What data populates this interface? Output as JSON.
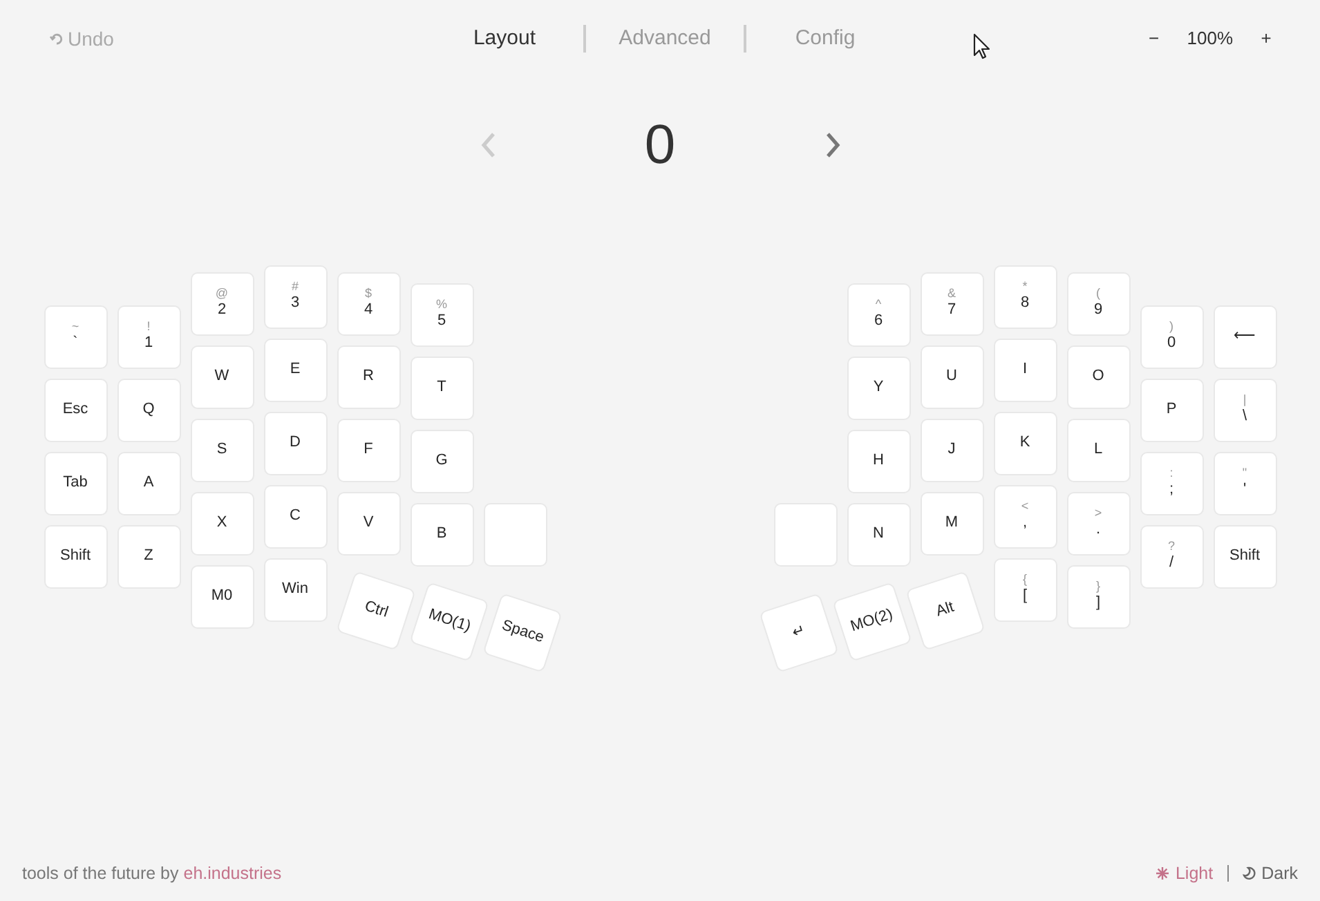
{
  "toolbar": {
    "undo": {
      "label": "Undo",
      "disabled": true
    },
    "tabs": [
      {
        "label": "Layout",
        "selected": true
      },
      {
        "label": "Advanced",
        "selected": false
      },
      {
        "label": "Config",
        "selected": false
      }
    ],
    "zoom": {
      "decrease": "−",
      "level": "100%",
      "increase": "+"
    }
  },
  "layer": {
    "number": "0",
    "previous_disabled": true,
    "next_disabled": false
  },
  "keyboard": {
    "halves": [
      {
        "kind": "left",
        "columns": [
          {
            "keys": [
              {
                "kind": "key",
                "shift": "~",
                "label": "`"
              },
              {
                "kind": "key",
                "label": "Esc"
              },
              {
                "kind": "key",
                "label": "Tab"
              },
              {
                "kind": "key",
                "label": "Shift"
              }
            ]
          },
          {
            "keys": [
              {
                "kind": "key",
                "shift": "!",
                "label": "1"
              },
              {
                "kind": "key",
                "label": "Q"
              },
              {
                "kind": "key",
                "label": "A"
              },
              {
                "kind": "key",
                "label": "Z"
              }
            ]
          },
          {
            "keys": [
              {
                "kind": "key",
                "shift": "@",
                "label": "2"
              },
              {
                "kind": "key",
                "label": "W"
              },
              {
                "kind": "key",
                "label": "S"
              },
              {
                "kind": "key",
                "label": "X"
              },
              {
                "kind": "key",
                "label": "M0"
              }
            ]
          },
          {
            "keys": [
              {
                "kind": "key",
                "shift": "#",
                "label": "3"
              },
              {
                "kind": "key",
                "label": "E"
              },
              {
                "kind": "key",
                "label": "D"
              },
              {
                "kind": "key",
                "label": "C"
              },
              {
                "kind": "key",
                "label": "Win"
              }
            ]
          },
          {
            "keys": [
              {
                "kind": "key",
                "shift": "$",
                "label": "4"
              },
              {
                "kind": "key",
                "label": "R"
              },
              {
                "kind": "key",
                "label": "F"
              },
              {
                "kind": "key",
                "label": "V"
              },
              {
                "kind": "thumb",
                "label": "Ctrl"
              }
            ]
          },
          {
            "keys": [
              {
                "kind": "key",
                "shift": "%",
                "label": "5"
              },
              {
                "kind": "key",
                "label": "T"
              },
              {
                "kind": "key",
                "label": "G"
              },
              {
                "kind": "key",
                "label": "B"
              },
              {
                "kind": "thumb",
                "label": "MO(1)"
              }
            ]
          },
          {
            "keys": [
              {
                "kind": "blank"
              },
              {
                "kind": "thumb",
                "label": "Space"
              }
            ]
          }
        ]
      },
      {
        "kind": "right",
        "columns": [
          {
            "keys": [
              {
                "kind": "blank"
              },
              {
                "kind": "thumb",
                "label": "↵"
              }
            ]
          },
          {
            "keys": [
              {
                "kind": "key",
                "shift": "^",
                "label": "6"
              },
              {
                "kind": "key",
                "label": "Y"
              },
              {
                "kind": "key",
                "label": "H"
              },
              {
                "kind": "key",
                "label": "N"
              },
              {
                "kind": "thumb",
                "label": "MO(2)"
              }
            ]
          },
          {
            "keys": [
              {
                "kind": "key",
                "shift": "&",
                "label": "7"
              },
              {
                "kind": "key",
                "label": "U"
              },
              {
                "kind": "key",
                "label": "J"
              },
              {
                "kind": "key",
                "label": "M"
              },
              {
                "kind": "thumb",
                "label": "Alt"
              }
            ]
          },
          {
            "keys": [
              {
                "kind": "key",
                "shift": "*",
                "label": "8"
              },
              {
                "kind": "key",
                "label": "I"
              },
              {
                "kind": "key",
                "label": "K"
              },
              {
                "kind": "key",
                "shift": "<",
                "label": ","
              },
              {
                "kind": "key",
                "shift": "{",
                "label": "["
              }
            ]
          },
          {
            "keys": [
              {
                "kind": "key",
                "shift": "(",
                "label": "9"
              },
              {
                "kind": "key",
                "label": "O"
              },
              {
                "kind": "key",
                "label": "L"
              },
              {
                "kind": "key",
                "shift": ">",
                "label": "."
              },
              {
                "kind": "key",
                "shift": "}",
                "label": "]"
              }
            ]
          },
          {
            "keys": [
              {
                "kind": "key",
                "shift": ")",
                "label": "0"
              },
              {
                "kind": "key",
                "label": "P"
              },
              {
                "kind": "key",
                "shift": ":",
                "label": ";"
              },
              {
                "kind": "key",
                "shift": "?",
                "label": "/"
              }
            ]
          },
          {
            "keys": [
              {
                "kind": "key",
                "label": "⟵"
              },
              {
                "kind": "key",
                "shift": "|",
                "label": "\\"
              },
              {
                "kind": "key",
                "shift": "\"",
                "label": "'"
              },
              {
                "kind": "key",
                "label": "Shift"
              }
            ]
          }
        ]
      }
    ]
  },
  "footer": {
    "credit": "tools of the future by",
    "link": "eh.industries",
    "themes": [
      {
        "label": "Light",
        "selected": true
      },
      {
        "label": "Dark",
        "selected": false
      }
    ]
  }
}
